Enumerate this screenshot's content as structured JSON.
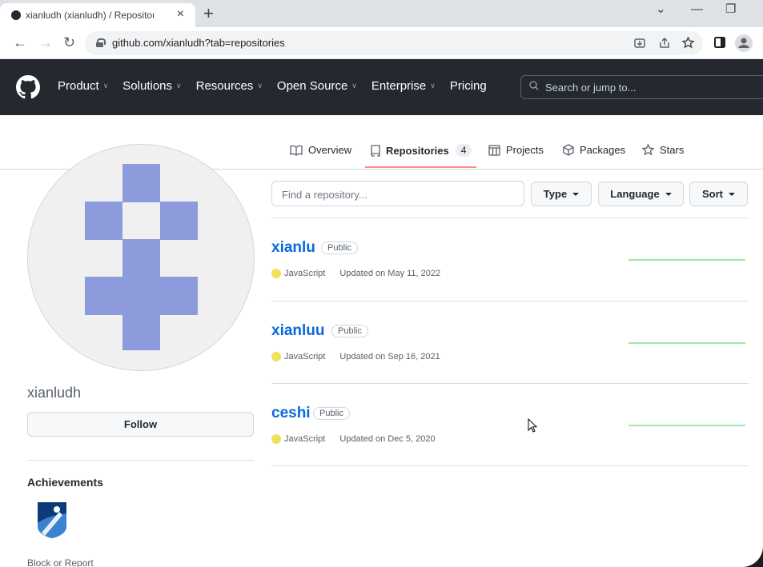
{
  "browser": {
    "tab_title": "xianludh (xianludh) / Repositories",
    "tab_close": "×",
    "new_tab": "+",
    "url": "github.com/xianludh?tab=repositories",
    "window_controls": {
      "dropdown": "⌄",
      "minimize": "—",
      "restore": "❐"
    },
    "nav": {
      "back": "←",
      "forward": "→",
      "reload": "↻"
    },
    "omnibox_icons": [
      "install-icon",
      "share-icon",
      "star-icon"
    ]
  },
  "github_header": {
    "nav": [
      {
        "label": "Product",
        "has_menu": true
      },
      {
        "label": "Solutions",
        "has_menu": true
      },
      {
        "label": "Resources",
        "has_menu": true
      },
      {
        "label": "Open Source",
        "has_menu": true
      },
      {
        "label": "Enterprise",
        "has_menu": true
      },
      {
        "label": "Pricing",
        "has_menu": false
      }
    ],
    "search_placeholder": "Search or jump to...",
    "search_shortcut": "/"
  },
  "profile_tabs": {
    "overview": "Overview",
    "repositories": "Repositories",
    "repositories_count": "4",
    "projects": "Projects",
    "packages": "Packages",
    "stars": "Stars"
  },
  "profile": {
    "username": "xianludh",
    "follow_label": "Follow",
    "achievements_title": "Achievements",
    "block_report": "Block or Report",
    "identicon_color": "#8d9bdc"
  },
  "filters": {
    "search_placeholder": "Find a repository...",
    "type_label": "Type",
    "language_label": "Language",
    "sort_label": "Sort"
  },
  "repos": [
    {
      "name": "xianlu",
      "visibility": "Public",
      "language": "JavaScript",
      "language_color": "#f1e05a",
      "updated": "Updated on May 11, 2022"
    },
    {
      "name": "xianluu",
      "visibility": "Public",
      "language": "JavaScript",
      "language_color": "#f1e05a",
      "updated": "Updated on Sep 16, 2021"
    },
    {
      "name": "ceshi",
      "visibility": "Public",
      "language": "JavaScript",
      "language_color": "#f1e05a",
      "updated": "Updated on Dec 5, 2020"
    }
  ]
}
